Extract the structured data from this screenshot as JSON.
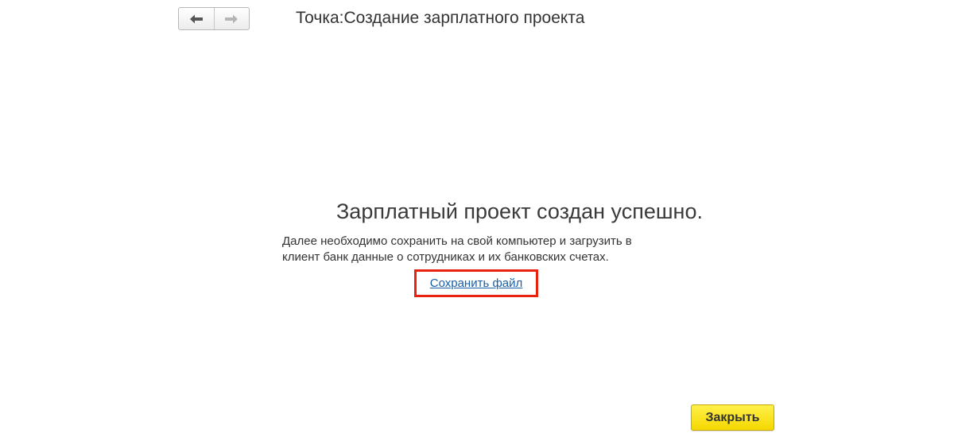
{
  "window": {
    "title": "Точка:Создание зарплатного проекта"
  },
  "nav": {
    "back_icon": "arrow-left-icon",
    "forward_icon": "arrow-right-icon"
  },
  "main": {
    "heading": "Зарплатный проект создан успешно.",
    "description_lines": [
      "Далее необходимо сохранить на свой компьютер и загрузить в",
      "клиент банк данные о сотрудниках и их банковских счетах."
    ],
    "save_link": "Сохранить файл"
  },
  "footer": {
    "close_label": "Закрыть"
  },
  "colors": {
    "link": "#1a5fa8",
    "highlight_frame": "#e8220f",
    "primary_button": "#f5d800"
  }
}
